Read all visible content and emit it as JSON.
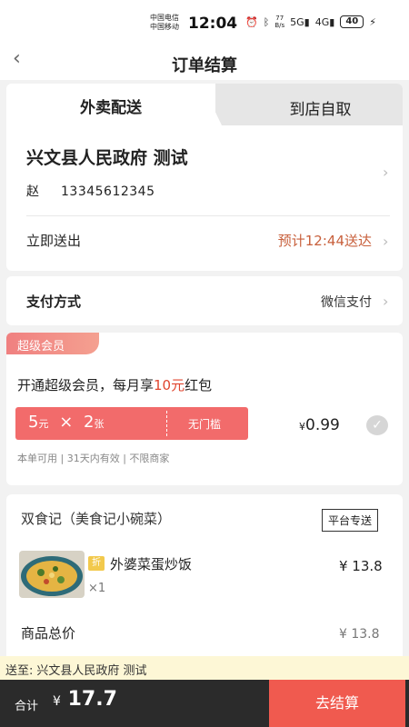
{
  "status_bar": {
    "carrier1": "中国电信",
    "carrier2": "中国移动",
    "time": "12:04",
    "net_speed_value": "77",
    "net_speed_unit": "B/s",
    "signal_label_5g": "5G",
    "signal_label_4g": "4G",
    "battery": "40"
  },
  "header": {
    "title": "订单结算"
  },
  "tabs": [
    {
      "label": "外卖配送",
      "active": true
    },
    {
      "label": "到店自取",
      "active": false
    }
  ],
  "address": {
    "title": "兴文县人民政府  测试",
    "name": "赵",
    "phone": "13345612345"
  },
  "delivery": {
    "label": "立即送出",
    "eta": "预计12:44送达"
  },
  "payment": {
    "label": "支付方式",
    "method": "微信支付"
  },
  "vip": {
    "badge": "超级会员",
    "title_prefix": "开通超级会员，每月享",
    "title_highlight": "10元",
    "title_suffix": "红包",
    "coupon_amount": "5",
    "coupon_unit": "元",
    "coupon_times": "×",
    "coupon_count": "2",
    "coupon_count_unit": "张",
    "coupon_tag": "无门槛",
    "price_symbol": "¥",
    "price": "0.99",
    "note": "本单可用 | 31天内有效 | 不限商家"
  },
  "shop": {
    "name": "双食记（美食记小碗菜）",
    "badge": "平台专送",
    "items": [
      {
        "discount_tag": "折",
        "name": "外婆菜蛋炒饭",
        "price": "¥ 13.8",
        "quantity": "×1"
      }
    ],
    "subtotal_label": "商品总价",
    "subtotal_value": "¥ 13.8"
  },
  "address_strip": {
    "label": "送至:",
    "value": "兴文县人民政府  测试"
  },
  "footer": {
    "total_label": "合计",
    "total_symbol": "¥",
    "total_value": "17.7",
    "checkout_label": "去结算"
  },
  "colors": {
    "accent": "#f05a4f",
    "eta": "#c8603c",
    "coupon": "#f26b6b"
  }
}
